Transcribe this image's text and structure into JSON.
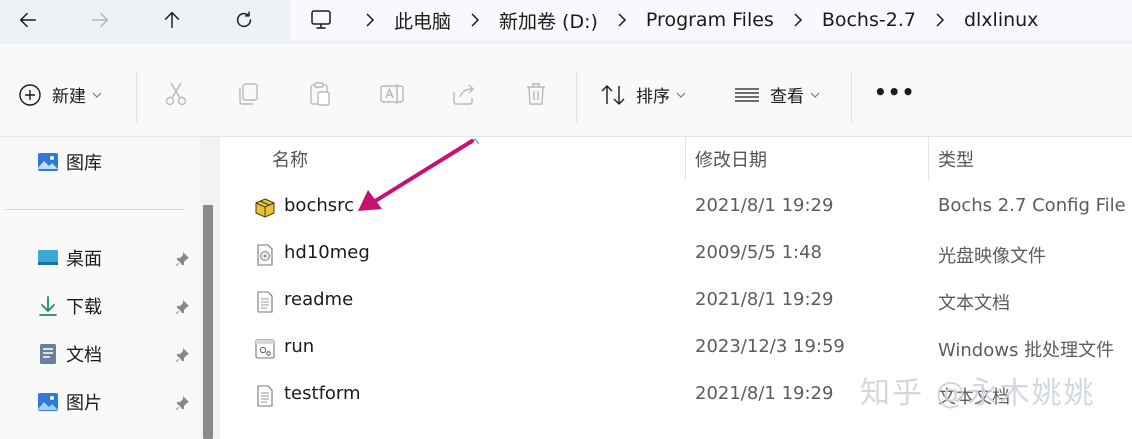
{
  "address_bar": {
    "breadcrumbs": [
      "此电脑",
      "新加卷 (D:)",
      "Program Files",
      "Bochs-2.7",
      "dlxlinux"
    ]
  },
  "toolbar": {
    "new_label": "新建",
    "sort_label": "排序",
    "view_label": "查看",
    "more_label": "•••"
  },
  "sidebar": {
    "items": [
      {
        "label": "图库",
        "icon": "gallery-icon"
      },
      {
        "label": "桌面",
        "icon": "desktop-icon",
        "pinned": true
      },
      {
        "label": "下载",
        "icon": "download-icon",
        "pinned": true
      },
      {
        "label": "文档",
        "icon": "document-icon",
        "pinned": true
      },
      {
        "label": "图片",
        "icon": "pictures-icon",
        "pinned": true
      }
    ]
  },
  "columns": {
    "name": "名称",
    "date": "修改日期",
    "type": "类型"
  },
  "files": [
    {
      "name": "bochsrc",
      "date": "2021/8/1 19:29",
      "type": "Bochs 2.7 Config File",
      "icon": "config-package-icon"
    },
    {
      "name": "hd10meg",
      "date": "2009/5/5 1:48",
      "type": "光盘映像文件",
      "icon": "disc-image-icon"
    },
    {
      "name": "readme",
      "date": "2021/8/1 19:29",
      "type": "文本文档",
      "icon": "text-file-icon"
    },
    {
      "name": "run",
      "date": "2023/12/3 19:59",
      "type": "Windows 批处理文件",
      "icon": "batch-file-icon"
    },
    {
      "name": "testform",
      "date": "2021/8/1 19:29",
      "type": "文本文档",
      "icon": "text-file-icon"
    }
  ],
  "watermark": "知乎 @永木姚姚",
  "colors": {
    "annotation_arrow": "#c8116e",
    "address_bg": "#eef2f7",
    "toolbar_bg": "#f9f9f9"
  }
}
